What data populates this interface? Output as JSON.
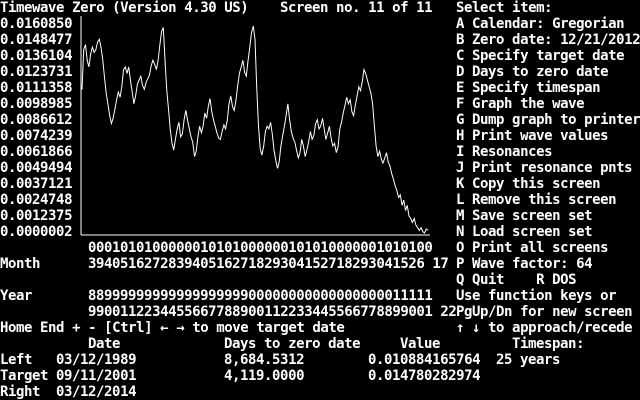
{
  "header": {
    "title": "Timewave Zero (Version 4.30 US)",
    "screen_label": "Screen no. 11 of 11"
  },
  "colors": {
    "background": "#000000",
    "foreground": "#ffffff"
  },
  "menu": {
    "heading": "Select item:",
    "items": [
      "A Calendar: Gregorian",
      "B Zero date: 12/21/2012",
      "C Specify target date",
      "D Days to zero date",
      "E Specify timespan",
      "F Graph the wave",
      "G Dump graph to printer",
      "H Print wave values",
      "I Resonances",
      "J Print resonance pnts",
      "K Copy this screen",
      "L Remove this screen",
      "M Save screen set",
      "N Load screen set",
      "O Print all screens",
      "P Wave factor: 64",
      "Q Quit    R DOS"
    ],
    "hint_1": "Use function keys or",
    "hint_2": "PgUp/Dn for new screen",
    "hint_3": "↑ ↓ to approach/recede"
  },
  "chart_data": {
    "type": "line",
    "title": "",
    "xlabel": "",
    "ylabel": "",
    "x_range": [
      "03/12/1989",
      "03/12/2014"
    ],
    "y_ticks": [
      "0.0160850",
      "0.0148477",
      "0.0136104",
      "0.0123731",
      "0.0111358",
      "0.0098985",
      "0.0086612",
      "0.0074239",
      "0.0061866",
      "0.0049494",
      "0.0037121",
      "0.0024748",
      "0.0012375",
      "0.0000002"
    ],
    "ylim": [
      2e-07,
      0.016085
    ],
    "grid": false,
    "series": [
      {
        "values": [
          0.01088,
          0.0139,
          0.0143,
          0.0131,
          0.0126,
          0.0136,
          0.0141,
          0.0137,
          0.0139,
          0.0145,
          0.0147,
          0.0141,
          0.0131,
          0.0118,
          0.0106,
          0.0098,
          0.0089,
          0.0083,
          0.0087,
          0.0094,
          0.0101,
          0.0107,
          0.0103,
          0.0111,
          0.0124,
          0.0126,
          0.0121,
          0.0126,
          0.0116,
          0.0107,
          0.0098,
          0.0104,
          0.0113,
          0.0116,
          0.0119,
          0.0112,
          0.0109,
          0.0114,
          0.0117,
          0.012,
          0.0127,
          0.0131,
          0.0128,
          0.0124,
          0.0131,
          0.0143,
          0.0153,
          0.0156,
          0.0131,
          0.0108,
          0.0094,
          0.0079,
          0.0068,
          0.0063,
          0.0071,
          0.0079,
          0.0084,
          0.0073,
          0.0075,
          0.0086,
          0.0093,
          0.0086,
          0.0079,
          0.0073,
          0.0069,
          0.0058,
          0.0062,
          0.0073,
          0.0081,
          0.0076,
          0.0081,
          0.0091,
          0.0087,
          0.0096,
          0.0102,
          0.0092,
          0.0086,
          0.0081,
          0.0076,
          0.0072,
          0.0071,
          0.0077,
          0.0082,
          0.0079,
          0.0086,
          0.0098,
          0.0104,
          0.0096,
          0.0093,
          0.0101,
          0.0112,
          0.0121,
          0.0126,
          0.0131,
          0.0122,
          0.0119,
          0.0131,
          0.0141,
          0.0152,
          0.0157,
          0.0147,
          0.0111,
          0.0081,
          0.0064,
          0.0059,
          0.0066,
          0.0077,
          0.0081,
          0.0079,
          0.0084,
          0.0075,
          0.0063,
          0.0055,
          0.0049,
          0.0054,
          0.0066,
          0.0074,
          0.0081,
          0.0089,
          0.0098,
          0.0086,
          0.0077,
          0.0072,
          0.0069,
          0.0063,
          0.0057,
          0.0061,
          0.0071,
          0.0066,
          0.0058,
          0.0063,
          0.0069,
          0.0077,
          0.0071,
          0.0074,
          0.0083,
          0.0086,
          0.0079,
          0.0081,
          0.0087,
          0.0079,
          0.0071,
          0.0076,
          0.0081,
          0.0072,
          0.0066,
          0.0068,
          0.0061,
          0.0065,
          0.0079,
          0.0084,
          0.0091,
          0.0097,
          0.0103,
          0.0098,
          0.0101,
          0.0092,
          0.0089,
          0.0097,
          0.0104,
          0.0111,
          0.0108,
          0.0115,
          0.0124,
          0.0121,
          0.0116,
          0.0111,
          0.0106,
          0.0098,
          0.0081,
          0.0066,
          0.0058,
          0.0062,
          0.0056,
          0.0053,
          0.0057,
          0.0061,
          0.0054,
          0.0051,
          0.0045,
          0.0041,
          0.0036,
          0.0032,
          0.0027,
          0.0029,
          0.0021,
          0.0025,
          0.0017,
          0.0021,
          0.0013,
          0.0011,
          0.0008,
          0.0011,
          0.0006,
          0.0004,
          0.0002,
          0.0004,
          0.0001,
          0.0,
          0.0003,
          0.0002
        ]
      }
    ]
  },
  "axis": {
    "year_row_1": "0001010100000010101000000101010000001010100",
    "year_row_2": "3940516272839405162718293041527182930415261 7",
    "month_label": "Month",
    "month_digits": "394051627283940516271829304152718293041526 17",
    "year_label": "Year",
    "year_digits_1": "8899999999999999999900000000000000000011111",
    "year_digits_2": "9900112234455667788900112233445566778899001 22"
  },
  "status": {
    "key_help": "Home End + - [Ctrl] ← → to move target date",
    "col_date": "Date",
    "col_days": "Days to zero date",
    "col_value": "Value",
    "col_timespan": "Timespan:",
    "timespan_value": "25 years",
    "left_label": "Left",
    "left_date": "03/12/1989",
    "left_days": "8,684.5312",
    "left_value": "0.010884165764",
    "target_label": "Target",
    "target_date": "09/11/2001",
    "target_days": "4,119.0000",
    "target_value": "0.014780282974",
    "right_label": "Right",
    "right_date": "03/12/2014"
  }
}
